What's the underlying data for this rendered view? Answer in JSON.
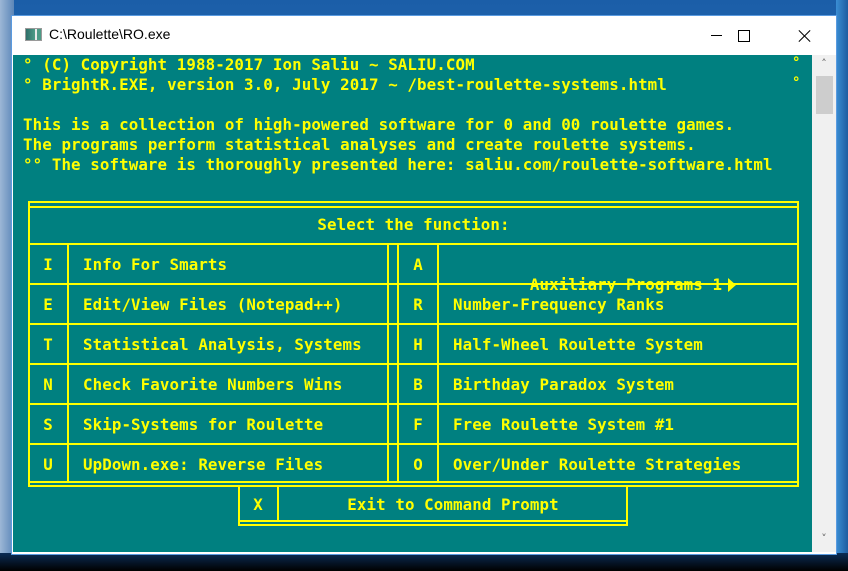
{
  "window": {
    "title": "C:\\Roulette\\RO.exe",
    "controls": {
      "minimize": "minimize",
      "maximize": "maximize",
      "close": "close"
    }
  },
  "console": {
    "header_lines": [
      "° (C) Copyright 1988-2017 Ion Saliu ~ SALIU.COM",
      "° BrightR.EXE, version 3.0, July 2017 ~ /best-roulette-systems.html"
    ],
    "header_right_marks": [
      "°",
      "°"
    ],
    "intro_lines": [
      "This is a collection of high-powered software for 0 and 00 roulette games.",
      "The programs perform statistical analyses and create roulette systems.",
      "°° The software is thoroughly presented here: saliu.com/roulette-software.html"
    ],
    "colors": {
      "background": "#008080",
      "foreground": "#FFFF00"
    }
  },
  "menu": {
    "title": "Select the function:",
    "left": [
      {
        "key": "I",
        "label": "Info For Smarts"
      },
      {
        "key": "E",
        "label": "Edit/View Files (Notepad++)"
      },
      {
        "key": "T",
        "label": "Statistical Analysis, Systems"
      },
      {
        "key": "N",
        "label": "Check Favorite Numbers Wins"
      },
      {
        "key": "S",
        "label": "Skip-Systems for Roulette"
      },
      {
        "key": "U",
        "label": "UpDown.exe: Reverse Files"
      }
    ],
    "right": [
      {
        "key": "A",
        "label": "Auxiliary Programs 1",
        "submenu_icon": "arrow-right-icon"
      },
      {
        "key": "R",
        "label": "Number-Frequency Ranks"
      },
      {
        "key": "H",
        "label": "Half-Wheel Roulette System"
      },
      {
        "key": "B",
        "label": "Birthday Paradox System"
      },
      {
        "key": "F",
        "label": "Free Roulette System #1"
      },
      {
        "key": "O",
        "label": "Over/Under Roulette Strategies"
      }
    ],
    "exit": {
      "key": "X",
      "label": "Exit to Command Prompt"
    }
  },
  "scrollbar": {
    "up": "^",
    "down": "v"
  }
}
